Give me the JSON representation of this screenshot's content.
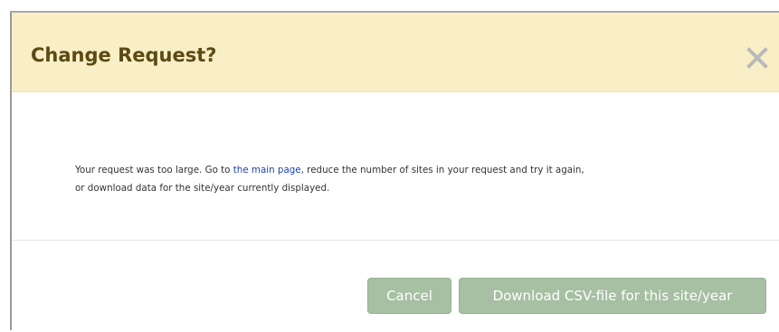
{
  "dialog": {
    "title": "Change Request?",
    "close_icon": "close-x-icon",
    "body": {
      "text_before_link": "Your request was too large. Go to ",
      "link_text": "the main page",
      "text_after_link": ", reduce the number of sites in your request and try it again,",
      "line2": "or download data for the site/year currently displayed."
    },
    "buttons": {
      "cancel_label": "Cancel",
      "download_label": "Download CSV-file for this site/year"
    }
  },
  "colors": {
    "header_background": "#f9efc6",
    "title_text": "#5b4a14",
    "link": "#1f43b0",
    "button_background": "#a7bfa3"
  }
}
